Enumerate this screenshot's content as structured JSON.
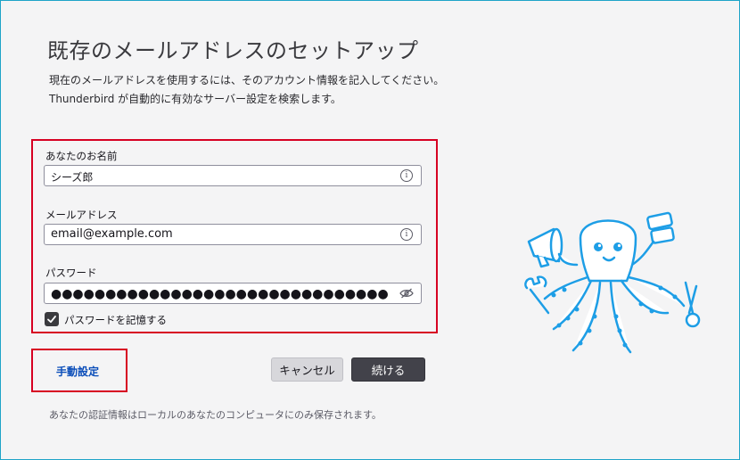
{
  "page": {
    "title": "既存のメールアドレスのセットアップ",
    "description_line1": "現在のメールアドレスを使用するには、そのアカウント情報を記入してください。",
    "description_line2": "Thunderbird が自動的に有効なサーバー設定を検索します。"
  },
  "form": {
    "name": {
      "label": "あなたのお名前",
      "value": "シーズ郎",
      "icon": "info-icon"
    },
    "email": {
      "label": "メールアドレス",
      "value": "email@example.com",
      "icon": "info-icon"
    },
    "password": {
      "label": "パスワード",
      "masked_value": "●●●●●●●●●●●●●●●●●●●●●●●●●●●●●●●",
      "icon": "eye-off-icon"
    },
    "remember_password": {
      "label": "パスワードを記憶する",
      "checked": true
    }
  },
  "actions": {
    "manual_config": "手動設定",
    "cancel": "キャンセル",
    "continue": "続ける"
  },
  "footer": {
    "note": "あなたの認証情報はローカルのあなたのコンピュータにのみ保存されます。"
  },
  "colors": {
    "highlight_border": "#d70022",
    "link": "#0a4db9",
    "primary_button": "#42424a",
    "mascot_blue": "#1d9ee6"
  }
}
